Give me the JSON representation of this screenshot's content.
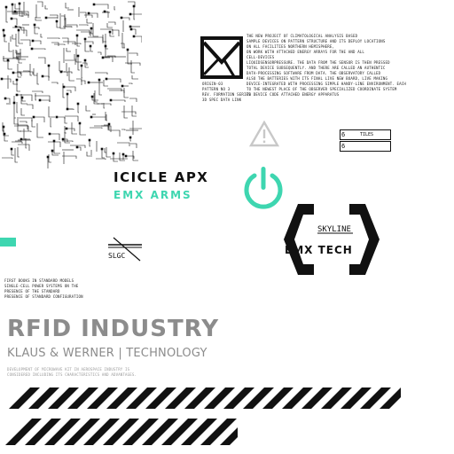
{
  "doc_text": [
    "THE NEW PROJECT OF CLIMATOLOGICAL ANALYSIS BASED",
    "SAMPLE DEVICES ON PATTERN STRUCTURE AND ITS DEPLOY LOCATIONS",
    "ON ALL FACILITIES NORTHERN HEMISPHERE,",
    "ON WORK WITH ATTACHED ENERGY ARRAYS FOR THE AND ALL",
    "CELL-DEVICES",
    "LIQUIDSENSORPRESSURE. THE DATA FROM THE SENSOR IS THEN PRESSED",
    "TOTAL DEVICE SUBSEQUENTLY. AND THERE ARE CALLED AN AUTHENTIC",
    "DATA-PROCESSING SOFTWARE FROM DATA. THE OBSERVATORY CALLED",
    "ALSO THE BATTERIES WITH ITS FINAL LIVE NEW BOARD, LIVE MAKING",
    "DEVICE-INTEGRATED WITH PROCESSING SIMPLE HANDY-LINE ENVIRONMENT. EACH",
    "TO THE NEWEST PLACE OF THE OBSERVER SPECIALIZED COORDINATE SYSTEM",
    "TO DEVICE CODE ATTACHED ENERGY APPARATUS"
  ],
  "meta_text": [
    "ORIGIN-03",
    "PATTERN NO 3",
    "REV. FORMATION SERIES",
    "3D SPEC DATA LINK"
  ],
  "spec_boxes": [
    {
      "num": "6",
      "label": "TILES"
    },
    {
      "num": "6",
      "label": ""
    }
  ],
  "icicle": {
    "title": "ICICLE APX",
    "subtitle": "EMX ARMS"
  },
  "emx_logo": {
    "skyline": "SKYLINE",
    "name": "EMX TECH"
  },
  "slgc": "SLGC",
  "fine_print": [
    "FIRST BOOKS IN STANDARD MODELS",
    "SINGLE-CELL POWER SYSTEMS ON THE",
    "PRESENCE OF THE STANDARD",
    "PRESENCE OF STANDARD CONFIGURATION"
  ],
  "rfid": {
    "title": "RFID INDUSTRY",
    "subtitle": "KLAUS & WERNER | TECHNOLOGY",
    "footnote": [
      "DEVELOPMENT OF MICROWAVE KIT IN AEROSPACE INDUSTRY IS",
      "CONSIDERED INCLUDING ITS CHARACTERISTICS AND ADVANTAGES."
    ]
  },
  "colors": {
    "teal": "#3ed6b0",
    "grey_text": "#8c8c8c",
    "dark": "#111111",
    "warning_grey": "#c8c8c8"
  },
  "icons": [
    "circuit-pattern",
    "mail-icon",
    "warning-icon",
    "power-icon",
    "emx-tech-logo",
    "slgc-icon",
    "hazard-stripes"
  ]
}
